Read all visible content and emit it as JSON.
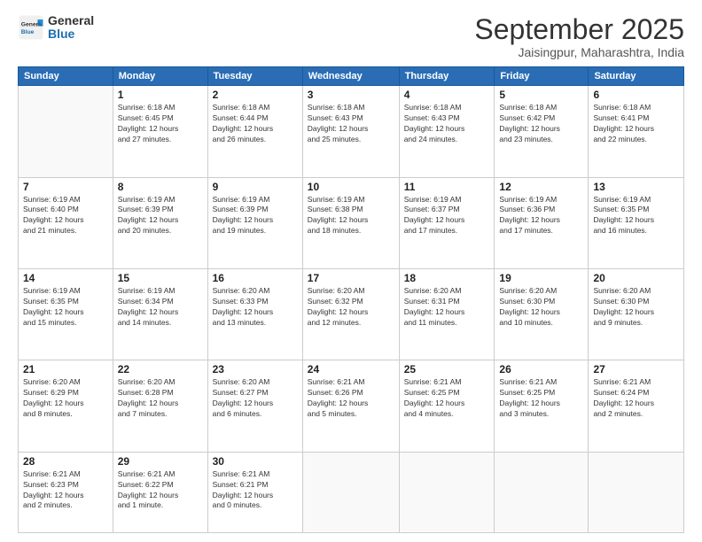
{
  "logo": {
    "line1": "General",
    "line2": "Blue"
  },
  "title": "September 2025",
  "subtitle": "Jaisingpur, Maharashtra, India",
  "days_of_week": [
    "Sunday",
    "Monday",
    "Tuesday",
    "Wednesday",
    "Thursday",
    "Friday",
    "Saturday"
  ],
  "weeks": [
    [
      {
        "day": "",
        "info": ""
      },
      {
        "day": "1",
        "info": "Sunrise: 6:18 AM\nSunset: 6:45 PM\nDaylight: 12 hours\nand 27 minutes."
      },
      {
        "day": "2",
        "info": "Sunrise: 6:18 AM\nSunset: 6:44 PM\nDaylight: 12 hours\nand 26 minutes."
      },
      {
        "day": "3",
        "info": "Sunrise: 6:18 AM\nSunset: 6:43 PM\nDaylight: 12 hours\nand 25 minutes."
      },
      {
        "day": "4",
        "info": "Sunrise: 6:18 AM\nSunset: 6:43 PM\nDaylight: 12 hours\nand 24 minutes."
      },
      {
        "day": "5",
        "info": "Sunrise: 6:18 AM\nSunset: 6:42 PM\nDaylight: 12 hours\nand 23 minutes."
      },
      {
        "day": "6",
        "info": "Sunrise: 6:18 AM\nSunset: 6:41 PM\nDaylight: 12 hours\nand 22 minutes."
      }
    ],
    [
      {
        "day": "7",
        "info": "Sunrise: 6:19 AM\nSunset: 6:40 PM\nDaylight: 12 hours\nand 21 minutes."
      },
      {
        "day": "8",
        "info": "Sunrise: 6:19 AM\nSunset: 6:39 PM\nDaylight: 12 hours\nand 20 minutes."
      },
      {
        "day": "9",
        "info": "Sunrise: 6:19 AM\nSunset: 6:39 PM\nDaylight: 12 hours\nand 19 minutes."
      },
      {
        "day": "10",
        "info": "Sunrise: 6:19 AM\nSunset: 6:38 PM\nDaylight: 12 hours\nand 18 minutes."
      },
      {
        "day": "11",
        "info": "Sunrise: 6:19 AM\nSunset: 6:37 PM\nDaylight: 12 hours\nand 17 minutes."
      },
      {
        "day": "12",
        "info": "Sunrise: 6:19 AM\nSunset: 6:36 PM\nDaylight: 12 hours\nand 17 minutes."
      },
      {
        "day": "13",
        "info": "Sunrise: 6:19 AM\nSunset: 6:35 PM\nDaylight: 12 hours\nand 16 minutes."
      }
    ],
    [
      {
        "day": "14",
        "info": "Sunrise: 6:19 AM\nSunset: 6:35 PM\nDaylight: 12 hours\nand 15 minutes."
      },
      {
        "day": "15",
        "info": "Sunrise: 6:19 AM\nSunset: 6:34 PM\nDaylight: 12 hours\nand 14 minutes."
      },
      {
        "day": "16",
        "info": "Sunrise: 6:20 AM\nSunset: 6:33 PM\nDaylight: 12 hours\nand 13 minutes."
      },
      {
        "day": "17",
        "info": "Sunrise: 6:20 AM\nSunset: 6:32 PM\nDaylight: 12 hours\nand 12 minutes."
      },
      {
        "day": "18",
        "info": "Sunrise: 6:20 AM\nSunset: 6:31 PM\nDaylight: 12 hours\nand 11 minutes."
      },
      {
        "day": "19",
        "info": "Sunrise: 6:20 AM\nSunset: 6:30 PM\nDaylight: 12 hours\nand 10 minutes."
      },
      {
        "day": "20",
        "info": "Sunrise: 6:20 AM\nSunset: 6:30 PM\nDaylight: 12 hours\nand 9 minutes."
      }
    ],
    [
      {
        "day": "21",
        "info": "Sunrise: 6:20 AM\nSunset: 6:29 PM\nDaylight: 12 hours\nand 8 minutes."
      },
      {
        "day": "22",
        "info": "Sunrise: 6:20 AM\nSunset: 6:28 PM\nDaylight: 12 hours\nand 7 minutes."
      },
      {
        "day": "23",
        "info": "Sunrise: 6:20 AM\nSunset: 6:27 PM\nDaylight: 12 hours\nand 6 minutes."
      },
      {
        "day": "24",
        "info": "Sunrise: 6:21 AM\nSunset: 6:26 PM\nDaylight: 12 hours\nand 5 minutes."
      },
      {
        "day": "25",
        "info": "Sunrise: 6:21 AM\nSunset: 6:25 PM\nDaylight: 12 hours\nand 4 minutes."
      },
      {
        "day": "26",
        "info": "Sunrise: 6:21 AM\nSunset: 6:25 PM\nDaylight: 12 hours\nand 3 minutes."
      },
      {
        "day": "27",
        "info": "Sunrise: 6:21 AM\nSunset: 6:24 PM\nDaylight: 12 hours\nand 2 minutes."
      }
    ],
    [
      {
        "day": "28",
        "info": "Sunrise: 6:21 AM\nSunset: 6:23 PM\nDaylight: 12 hours\nand 2 minutes."
      },
      {
        "day": "29",
        "info": "Sunrise: 6:21 AM\nSunset: 6:22 PM\nDaylight: 12 hours\nand 1 minute."
      },
      {
        "day": "30",
        "info": "Sunrise: 6:21 AM\nSunset: 6:21 PM\nDaylight: 12 hours\nand 0 minutes."
      },
      {
        "day": "",
        "info": ""
      },
      {
        "day": "",
        "info": ""
      },
      {
        "day": "",
        "info": ""
      },
      {
        "day": "",
        "info": ""
      }
    ]
  ]
}
